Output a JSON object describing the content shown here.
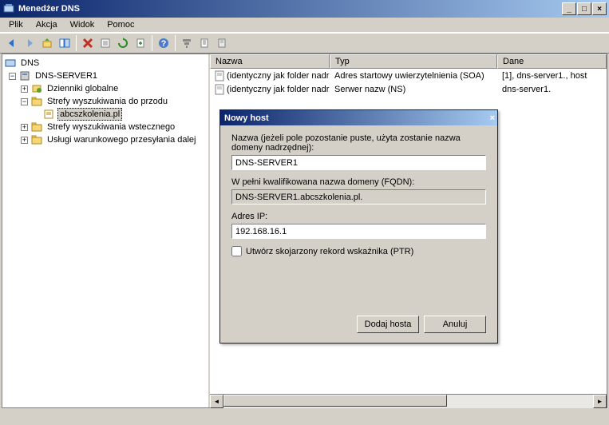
{
  "window": {
    "title": "Menedżer DNS"
  },
  "menu": {
    "file": "Plik",
    "action": "Akcja",
    "view": "Widok",
    "help": "Pomoc"
  },
  "tree": {
    "root": "DNS",
    "server": "DNS-SERVER1",
    "globalLogs": "Dzienniki globalne",
    "fwdZones": "Strefy wyszukiwania do przodu",
    "zone": "abcszkolenia.pl",
    "revZones": "Strefy wyszukiwania wstecznego",
    "condFwd": "Usługi warunkowego przesyłania dalej"
  },
  "columns": {
    "name": "Nazwa",
    "type": "Typ",
    "data": "Dane"
  },
  "records": [
    {
      "name": "(identyczny jak folder nadrzę...",
      "type": "Adres startowy uwierzytelnienia (SOA)",
      "data": "[1], dns-server1., host"
    },
    {
      "name": "(identyczny jak folder nadrzę...",
      "type": "Serwer nazw (NS)",
      "data": "dns-server1."
    }
  ],
  "dialog": {
    "title": "Nowy host",
    "nameLabel": "Nazwa (jeżeli pole pozostanie puste, użyta zostanie nazwa domeny nadrzędnej):",
    "nameValue": "DNS-SERVER1",
    "fqdnLabel": "W pełni kwalifikowana nazwa domeny (FQDN):",
    "fqdnValue": "DNS-SERVER1.abcszkolenia.pl.",
    "ipLabel": "Adres IP:",
    "ipValue": "192.168.16.1",
    "ptrLabel": "Utwórz skojarzony rekord wskaźnika (PTR)",
    "addBtn": "Dodaj hosta",
    "cancelBtn": "Anuluj"
  }
}
